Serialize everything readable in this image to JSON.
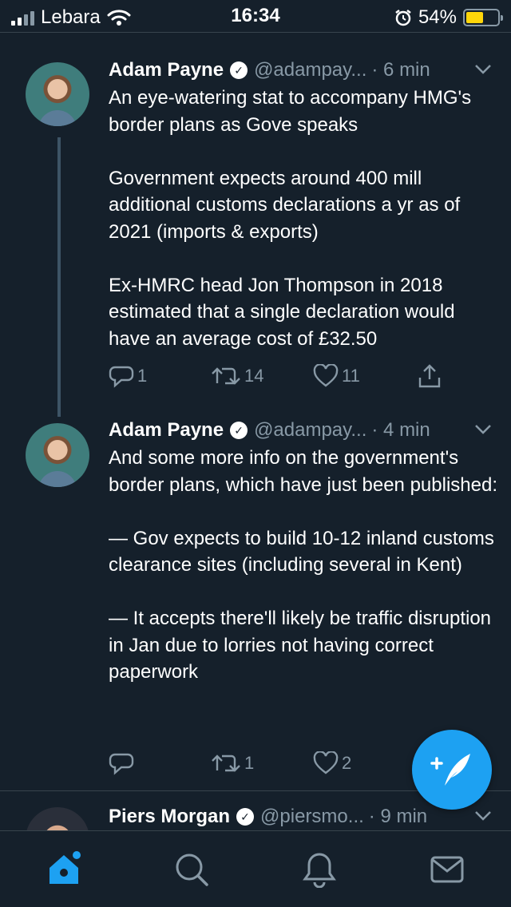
{
  "status_bar": {
    "carrier": "Lebara",
    "time": "16:34",
    "battery_percent": "54%",
    "battery_level": 0.54,
    "icons": [
      "signal-icon",
      "wifi-icon",
      "alarm-icon",
      "battery-icon"
    ]
  },
  "tweets": [
    {
      "name": "Adam Payne",
      "handle": "@adampay...",
      "time": "· 6 min",
      "text": "An eye-watering stat to accompany HMG's border plans as Gove speaks\n\nGovernment expects around 400 mill additional customs declarations a yr as of 2021 (imports & exports)\n\nEx-HMRC head Jon Thompson in 2018 estimated that a single declaration would have an average cost of £32.50",
      "replies": "1",
      "retweets": "14",
      "likes": "11"
    },
    {
      "name": "Adam Payne",
      "handle": "@adampay...",
      "time": "· 4 min",
      "text": "And some more info on the government's border plans, which have just been published:\n\n— Gov expects to build 10-12 inland customs clearance sites (including several in Kent)\n\n— It accepts there'll likely be traffic disruption in Jan due to  lorries not having correct paperwork",
      "replies": "",
      "retweets": "1",
      "likes": "2"
    },
    {
      "name": "Piers Morgan",
      "handle": "@piersmo...",
      "time": "· 9 min"
    }
  ],
  "colors": {
    "background": "#15202b",
    "accent": "#1da1f2",
    "secondary_text": "#8899a6",
    "divider": "#38444d",
    "battery": "#ffd60a"
  },
  "tab_bar": {
    "tabs": [
      "home-icon",
      "search-icon",
      "notifications-icon",
      "messages-icon"
    ],
    "active": "home"
  }
}
